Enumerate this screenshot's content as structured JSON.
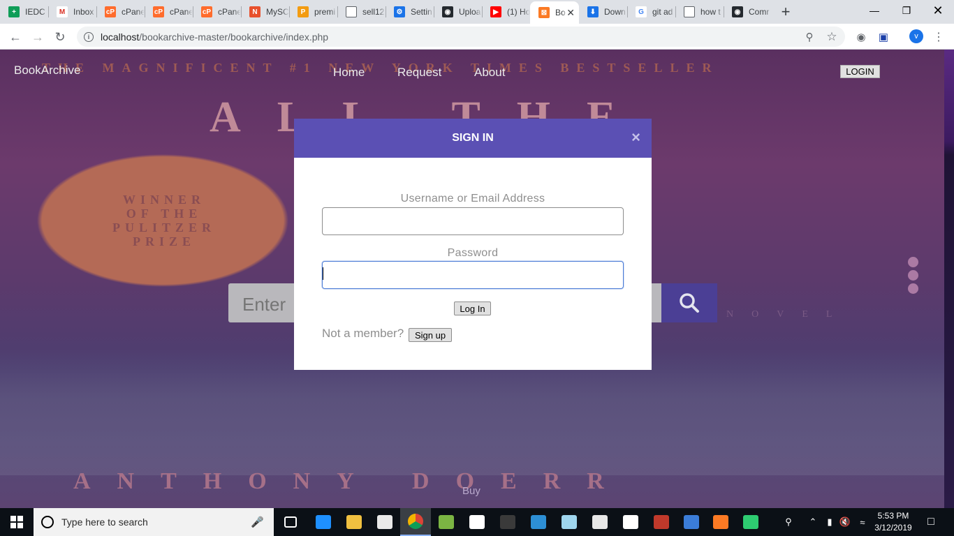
{
  "browser": {
    "tabs": [
      {
        "title": "IEDC",
        "fav": "sheets-icon",
        "color": "#0f9d58",
        "glyph": "+"
      },
      {
        "title": "Inbox",
        "fav": "gmail-icon",
        "color": "#ffffff",
        "glyph": "M"
      },
      {
        "title": "cPane",
        "fav": "cpanel-icon",
        "color": "#ff6c2c",
        "glyph": "cP"
      },
      {
        "title": "cPane",
        "fav": "cpanel-icon",
        "color": "#ff6c2c",
        "glyph": "cP"
      },
      {
        "title": "cPane",
        "fav": "cpanel-icon",
        "color": "#ff6c2c",
        "glyph": "cP"
      },
      {
        "title": "MySC",
        "fav": "mysql-icon",
        "color": "#e8502c",
        "glyph": "N"
      },
      {
        "title": "premi",
        "fav": "pma-icon",
        "color": "#f39c12",
        "glyph": "P"
      },
      {
        "title": "sell12",
        "fav": "page-icon",
        "color": "#ffffff",
        "glyph": ""
      },
      {
        "title": "Settin",
        "fav": "gear-icon",
        "color": "#1a73e8",
        "glyph": "⚙"
      },
      {
        "title": "Uploa",
        "fav": "github-icon",
        "color": "#24292e",
        "glyph": "◉"
      },
      {
        "title": "(1) Ho",
        "fav": "youtube-icon",
        "color": "#ff0000",
        "glyph": "▶"
      },
      {
        "title": "Bo",
        "fav": "xampp-icon",
        "color": "#fb7a24",
        "glyph": "⊠",
        "active": true
      },
      {
        "title": "Down",
        "fav": "download-icon",
        "color": "#1a73e8",
        "glyph": "⬇"
      },
      {
        "title": "git ad",
        "fav": "google-icon",
        "color": "#ffffff",
        "glyph": "G"
      },
      {
        "title": "how t",
        "fav": "page-icon",
        "color": "#ffffff",
        "glyph": ""
      },
      {
        "title": "Comr",
        "fav": "github-icon",
        "color": "#24292e",
        "glyph": "◉"
      }
    ],
    "url_host": "localhost",
    "url_path": "/bookarchive-master/bookarchive/index.php",
    "profile_initial": "v"
  },
  "site": {
    "brand": "BookArchive",
    "nav": [
      "Home",
      "Request",
      "About"
    ],
    "login_label": "LOGIN",
    "search_placeholder": "Enter",
    "buy_label": "Buy",
    "cover": {
      "top_line": "THE MAGNIFICENT #1 NEW YORK TIMES BESTSELLER",
      "title_fragment": "ALL THE",
      "badge": [
        "WINNER",
        "OF THE",
        "PULITZER",
        "PRIZE"
      ],
      "subtitle": "NOVEL",
      "author": "ANTHONY DOERR"
    }
  },
  "modal": {
    "title": "SIGN IN",
    "close_glyph": "×",
    "username_label": "Username or Email Address",
    "username_value": "",
    "password_label": "Password",
    "password_value": "",
    "login_button": "Log In",
    "not_member": "Not a member?",
    "signup_button": "Sign up",
    "header_color": "#5b50b4"
  },
  "taskbar": {
    "search_placeholder": "Type here to search",
    "time": "5:53 PM",
    "date": "3/12/2019"
  }
}
